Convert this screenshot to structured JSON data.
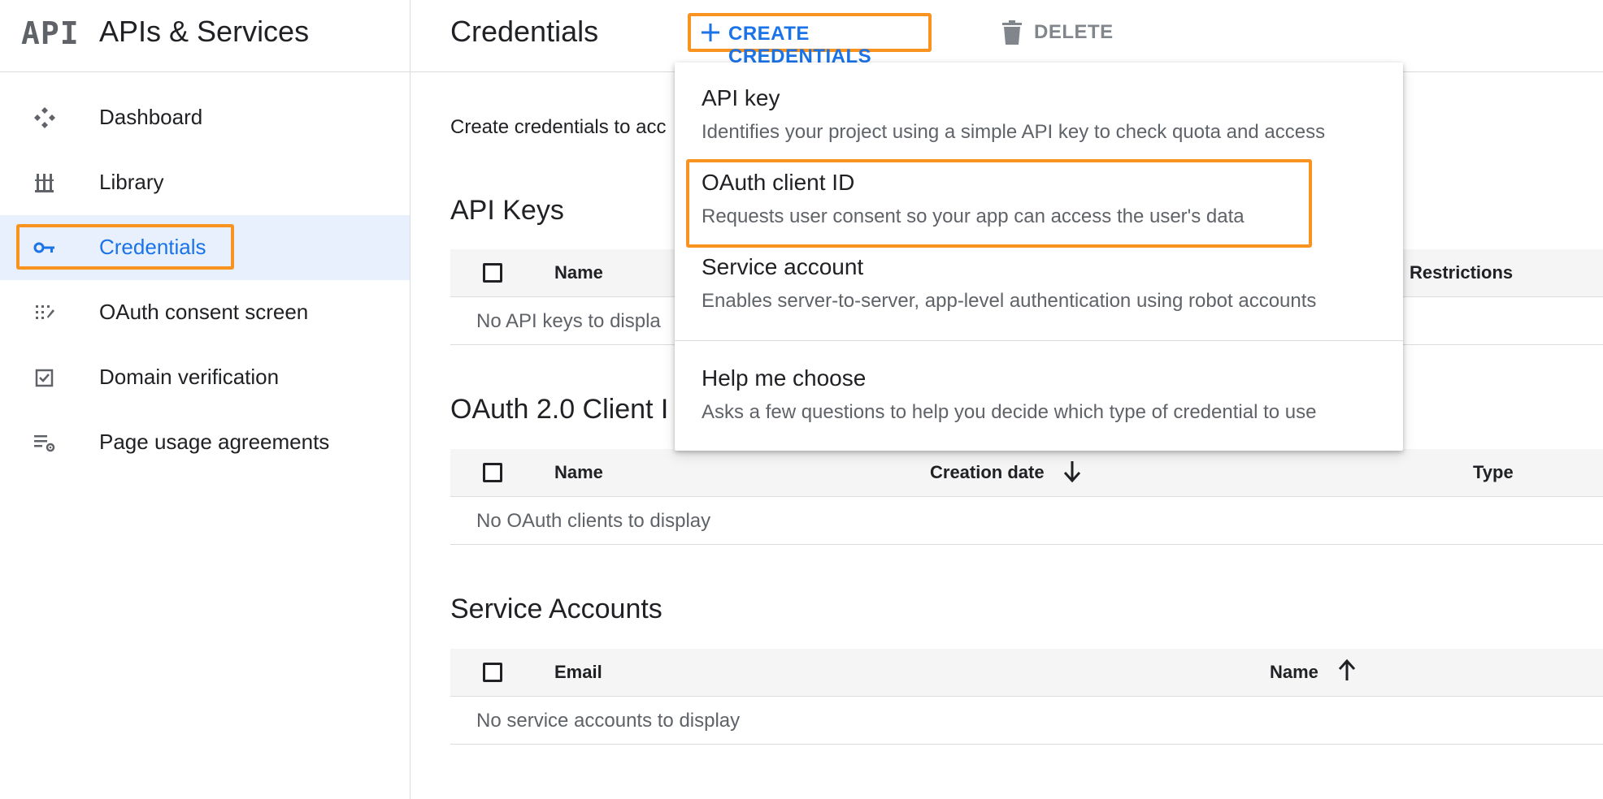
{
  "brand": {
    "logo_text": "API",
    "title": "APIs & Services"
  },
  "sidebar": {
    "items": [
      {
        "label": "Dashboard",
        "icon": "dashboard-icon"
      },
      {
        "label": "Library",
        "icon": "library-icon"
      },
      {
        "label": "Credentials",
        "icon": "key-icon",
        "active": true
      },
      {
        "label": "OAuth consent screen",
        "icon": "consent-icon"
      },
      {
        "label": "Domain verification",
        "icon": "checkbox-icon"
      },
      {
        "label": "Page usage agreements",
        "icon": "settings-list-icon"
      }
    ]
  },
  "header": {
    "title": "Credentials",
    "create_label": "CREATE CREDENTIALS",
    "delete_label": "DELETE"
  },
  "main": {
    "intro": "Create credentials to acc",
    "api_keys": {
      "title": "API Keys",
      "columns": [
        "Name",
        "Restrictions"
      ],
      "empty": "No API keys to displa"
    },
    "oauth_clients": {
      "title": "OAuth 2.0 Client I",
      "columns": [
        "Name",
        "Creation date",
        "Type"
      ],
      "empty": "No OAuth clients to display"
    },
    "service_accounts": {
      "title": "Service Accounts",
      "columns": [
        "Email",
        "Name"
      ],
      "empty": "No service accounts to display"
    }
  },
  "menu": {
    "items": [
      {
        "title": "API key",
        "desc": "Identifies your project using a simple API key to check quota and access"
      },
      {
        "title": "OAuth client ID",
        "desc": "Requests user consent so your app can access the user's data"
      },
      {
        "title": "Service account",
        "desc": "Enables server-to-server, app-level authentication using robot accounts"
      },
      {
        "title": "Help me choose",
        "desc": "Asks a few questions to help you decide which type of credential to use"
      }
    ]
  },
  "colors": {
    "accent": "#1a73e8",
    "highlight": "#f7931e",
    "active_bg": "#e8f0fe"
  }
}
